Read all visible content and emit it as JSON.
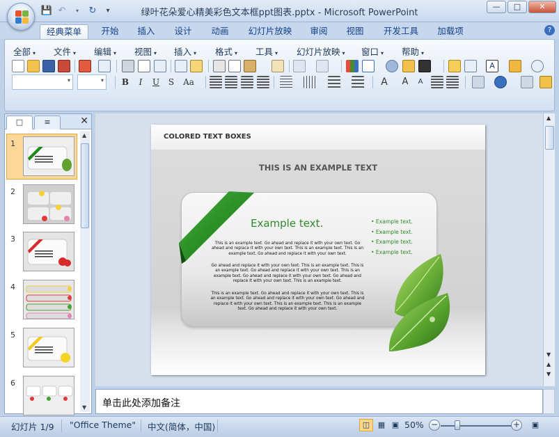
{
  "window": {
    "title": "绿叶花朵爱心精美彩色文本框ppt图表.pptx - Microsoft PowerPoint",
    "minimize_label": "—",
    "maximize_label": "□",
    "close_label": "✕"
  },
  "quick_access": {
    "save_icon": "save-icon",
    "undo_icon": "undo-icon",
    "redo_icon": "redo-icon",
    "customize_label": "▾"
  },
  "ribbon_tabs": [
    {
      "label": "经典菜单",
      "active": true
    },
    {
      "label": "开始"
    },
    {
      "label": "插入"
    },
    {
      "label": "设计"
    },
    {
      "label": "动画"
    },
    {
      "label": "幻灯片放映"
    },
    {
      "label": "审阅"
    },
    {
      "label": "视图"
    },
    {
      "label": "开发工具"
    },
    {
      "label": "加载项"
    }
  ],
  "menu_bar": [
    {
      "label": "全部"
    },
    {
      "label": "文件"
    },
    {
      "label": "编辑"
    },
    {
      "label": "视图"
    },
    {
      "label": "插入"
    },
    {
      "label": "格式"
    },
    {
      "label": "工具"
    },
    {
      "label": "幻灯片放映"
    },
    {
      "label": "窗口"
    },
    {
      "label": "帮助"
    }
  ],
  "format_toolbar": {
    "bold": "B",
    "italic": "I",
    "underline": "U",
    "shadow": "S",
    "case": "Aa",
    "font_name": "",
    "font_size": ""
  },
  "left_panel": {
    "slides": [
      {
        "num": "1"
      },
      {
        "num": "2"
      },
      {
        "num": "3"
      },
      {
        "num": "4"
      },
      {
        "num": "5"
      },
      {
        "num": "6"
      }
    ],
    "close_label": "✕"
  },
  "slide": {
    "header": "COLORED TEXT BOXES",
    "subtitle": "THIS IS AN EXAMPLE TEXT",
    "card_heading": "Example text.",
    "paragraphs": [
      "This is an example text. Go ahead and replace it with your own text. Go ahead and replace it with your own text. This is an example text. This is an example text. Go ahead and replace it with your own text.",
      "Go ahead and replace it with your own text. This is an example text. This is an example text. Go ahead and replace it with your own text. This is an example text. Go ahead and replace it with your own text. Go ahead and replace it with your own text. This is an example text.",
      "This is an example text. Go ahead and replace it with your own text. This is an example text. Go ahead and replace it with your own text. Go ahead and replace it with your own text. This is an example text. This is an example text. Go ahead and replace it with your own text."
    ],
    "bullets": [
      "Example text.",
      "Example text.",
      "Example text.",
      "Example text."
    ],
    "ribbon_color": "#1e8a1a",
    "accent_green": "#2f8a2a"
  },
  "notes": {
    "placeholder": "单击此处添加备注"
  },
  "status_bar": {
    "slide_info": "幻灯片 1/9",
    "theme": "\"Office Theme\"",
    "language": "中文(简体，中国)",
    "zoom": "50%",
    "zoom_level": 0.5
  }
}
